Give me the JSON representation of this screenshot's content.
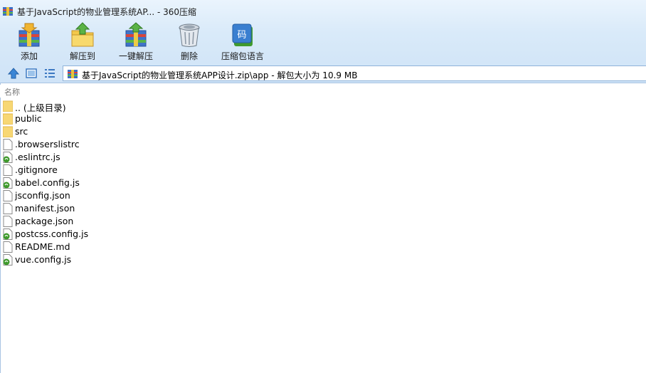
{
  "window": {
    "title": "基于JavaScript的物业管理系统AP... - 360压缩"
  },
  "toolbar": [
    {
      "label": "添加",
      "icon": "add-archive-icon"
    },
    {
      "label": "解压到",
      "icon": "extract-to-icon"
    },
    {
      "label": "一键解压",
      "icon": "one-click-extract-icon"
    },
    {
      "label": "删除",
      "icon": "delete-trash-icon"
    },
    {
      "label": "压缩包语言",
      "icon": "archive-language-icon"
    }
  ],
  "address": {
    "path": "基于JavaScript的物业管理系统APP设计.zip\\app - 解包大小为 10.9 MB"
  },
  "list": {
    "column_name": "名称",
    "items": [
      {
        "name": ".. (上级目录)",
        "type": "folder"
      },
      {
        "name": "public",
        "type": "folder"
      },
      {
        "name": "src",
        "type": "folder"
      },
      {
        "name": ".browserslistrc",
        "type": "file"
      },
      {
        "name": ".eslintrc.js",
        "type": "js"
      },
      {
        "name": ".gitignore",
        "type": "file"
      },
      {
        "name": "babel.config.js",
        "type": "js"
      },
      {
        "name": "jsconfig.json",
        "type": "file"
      },
      {
        "name": "manifest.json",
        "type": "file"
      },
      {
        "name": "package.json",
        "type": "file"
      },
      {
        "name": "postcss.config.js",
        "type": "js"
      },
      {
        "name": "README.md",
        "type": "file"
      },
      {
        "name": "vue.config.js",
        "type": "js"
      }
    ]
  },
  "colors": {
    "toolbar_bg": "#d9eaf9",
    "border": "#a9c4e2",
    "folder": "#f7d774",
    "js_badge": "#3f9a2d"
  }
}
